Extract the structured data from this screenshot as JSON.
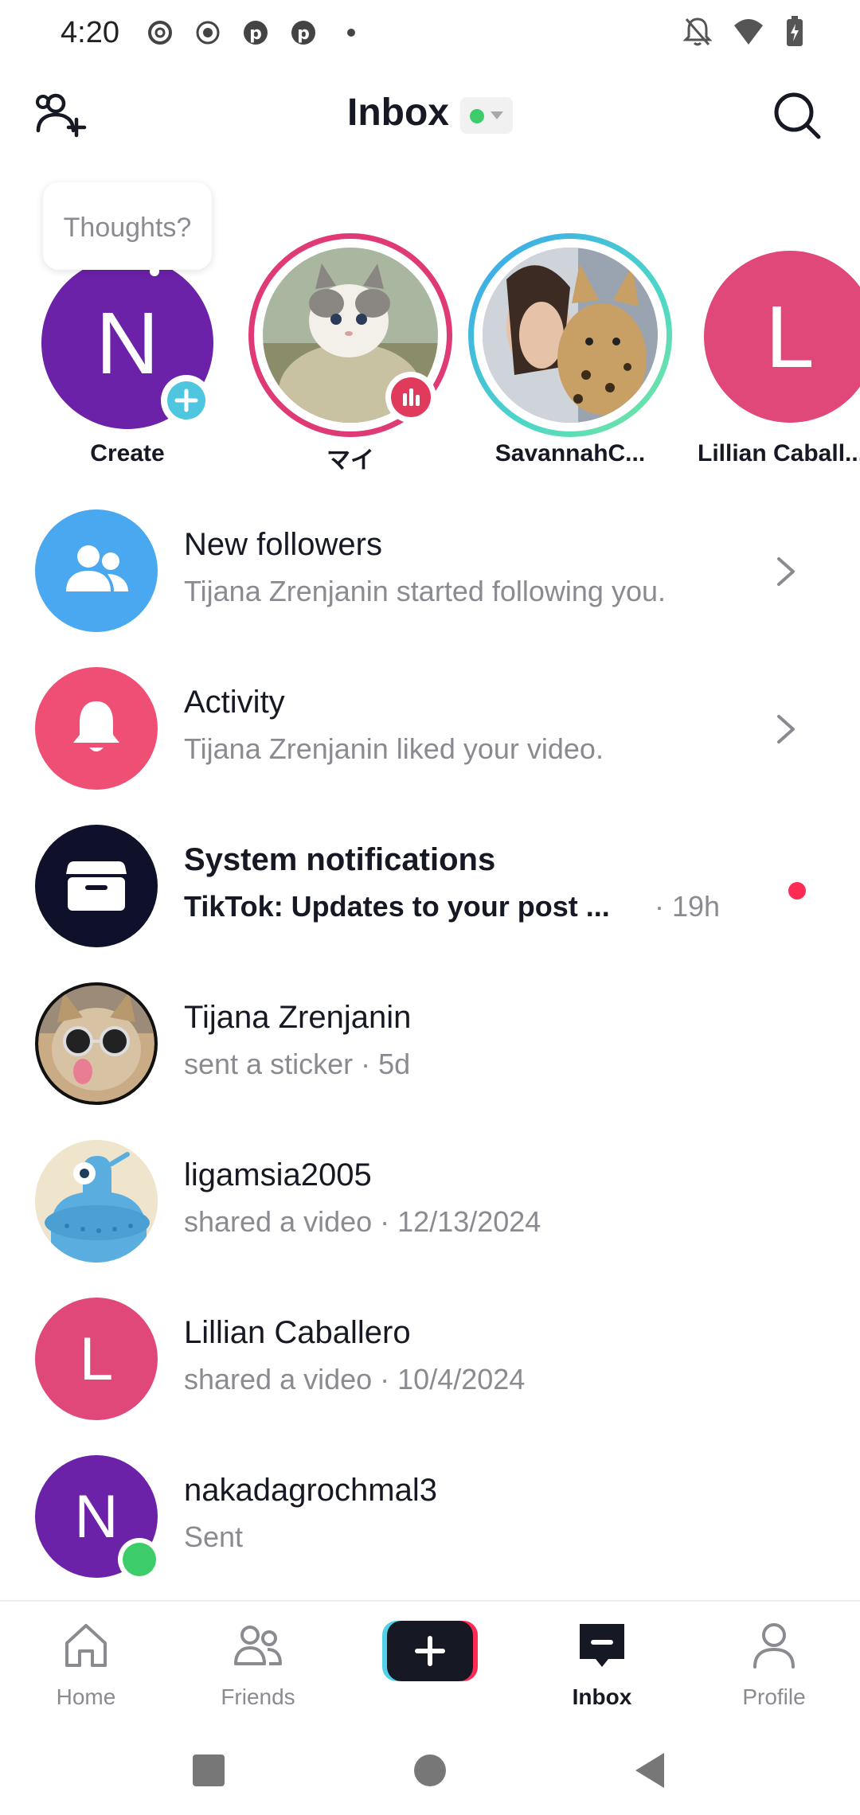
{
  "status_bar": {
    "time": "4:20"
  },
  "header": {
    "title": "Inbox"
  },
  "stories": {
    "tooltip": "Thoughts?",
    "items": [
      {
        "label": "Create",
        "initial": "N",
        "color": "#6b21a8"
      },
      {
        "label": "マイ"
      },
      {
        "label": "SavannahC..."
      },
      {
        "label": "Lillian Caball...",
        "initial": "L",
        "color": "#e0487a"
      }
    ]
  },
  "rows": [
    {
      "title": "New followers",
      "subtitle": "Tijana Zrenjanin started following you."
    },
    {
      "title": "Activity",
      "subtitle": "Tijana Zrenjanin liked your video."
    },
    {
      "title": "System notifications",
      "subtitle": "TikTok: Updates to your post ...",
      "time": "· 19h"
    },
    {
      "title": "Tijana Zrenjanin",
      "subtitle": "sent a sticker · 5d"
    },
    {
      "title": "ligamsia2005",
      "subtitle": "shared a video · 12/13/2024"
    },
    {
      "title": "Lillian Caballero",
      "subtitle": "shared a video · 10/4/2024",
      "initial": "L"
    },
    {
      "title": "nakadagrochmal3",
      "subtitle": "Sent",
      "initial": "N"
    }
  ],
  "bottom_nav": {
    "home": "Home",
    "friends": "Friends",
    "inbox": "Inbox",
    "profile": "Profile"
  },
  "colors": {
    "followers_blue": "#4aa8f0",
    "activity_pink": "#ef4f74",
    "system_navy": "#0f1029",
    "lillian_pink": "#e0487a",
    "purple": "#6b21a8",
    "online_green": "#3dcc6a",
    "unread_red": "#fe2c55"
  }
}
